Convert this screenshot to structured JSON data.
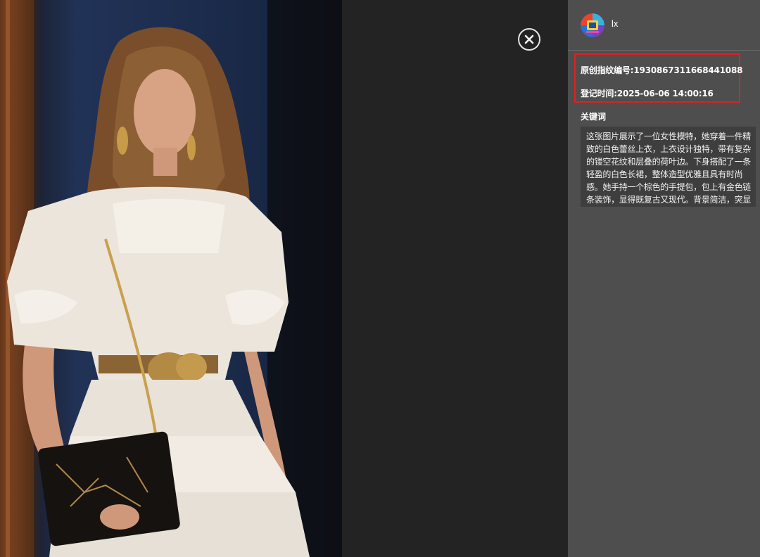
{
  "viewer": {
    "image_alt": "女性模特白色蕾丝连衣裙照片",
    "close_icon": "close-circle-icon"
  },
  "user": {
    "avatar_icon": "avatar-image",
    "name": "lx"
  },
  "fingerprint": {
    "id_text": "原创指纹编号:1930867311668441088",
    "time_text": "登记时间:2025-06-06 14:00:16",
    "highlight_color": "#e02020"
  },
  "keywords": {
    "title": "关键词",
    "description": "这张图片展示了一位女性模特，她穿着一件精致的白色蕾丝上衣，上衣设计独特，带有复杂的镂空花纹和层叠的荷叶边。下身搭配了一条轻盈的白色长裙，整体造型优雅且具有时尚感。她手持一个棕色的手提包，包上有金色链条装饰，显得既复古又现代。背景简洁，突显了服装的细节。"
  },
  "colors": {
    "panel_bg": "#4e4e4e",
    "viewer_bg": "#232323",
    "keyword_box_bg": "#3e3e3e"
  }
}
